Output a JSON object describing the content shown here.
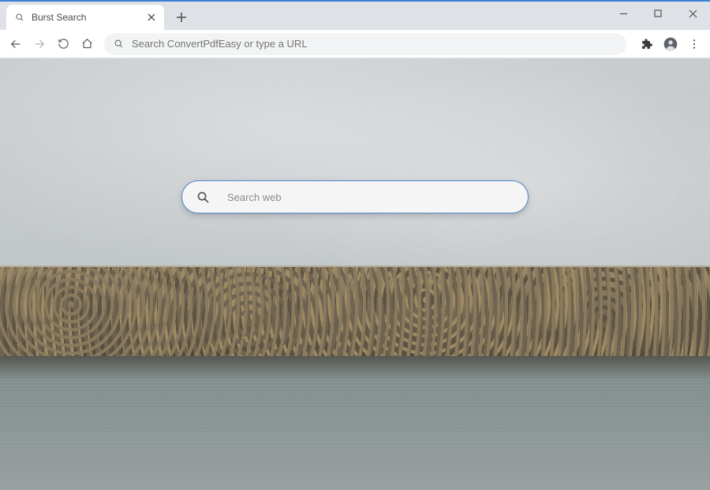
{
  "tab": {
    "title": "Burst Search"
  },
  "omnibox": {
    "placeholder": "Search ConvertPdfEasy or type a URL"
  },
  "page": {
    "search_placeholder": "Search web"
  }
}
